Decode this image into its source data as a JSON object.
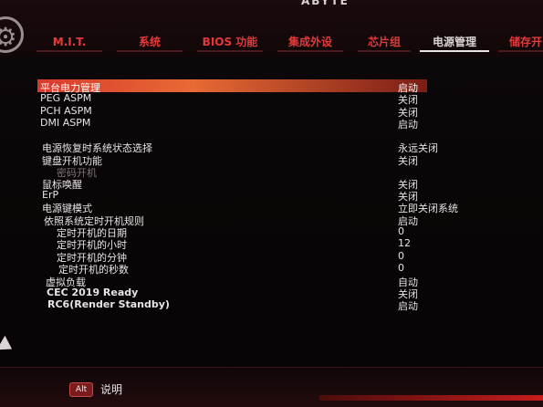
{
  "brand": "ABYTE",
  "tabs": [
    {
      "label": "M.I.T."
    },
    {
      "label": "系统"
    },
    {
      "label": "BIOS 功能"
    },
    {
      "label": "集成外设"
    },
    {
      "label": "芯片组"
    },
    {
      "label": "电源管理"
    },
    {
      "label": "储存开"
    }
  ],
  "active_tab": "电源管理",
  "settings": [
    {
      "label": "平台电力管理",
      "value": "启动",
      "selected": true
    },
    {
      "label": "PEG ASPM",
      "value": "关闭"
    },
    {
      "label": "PCH ASPM",
      "value": "关闭"
    },
    {
      "label": "DMI ASPM",
      "value": "启动"
    },
    {
      "label": "电源恢复时系统状态选择",
      "value": "永远关闭"
    },
    {
      "label": "键盘开机功能",
      "value": "关闭"
    },
    {
      "label": "密码开机",
      "value": "",
      "disabled": true
    },
    {
      "label": "鼠标唤醒",
      "value": "关闭"
    },
    {
      "label": "ErP",
      "value": "关闭"
    },
    {
      "label": "电源键模式",
      "value": "立即关闭系统"
    },
    {
      "label": "依照系统定时开机规则",
      "value": "启动"
    },
    {
      "label": "定时开机的日期",
      "value": "0"
    },
    {
      "label": "定时开机的小时",
      "value": "12"
    },
    {
      "label": "定时开机的分钟",
      "value": "0"
    },
    {
      "label": "定时开机的秒数",
      "value": "0"
    },
    {
      "label": "虚拟负载",
      "value": "自动"
    },
    {
      "label": "CEC 2019 Ready",
      "value": "关闭"
    },
    {
      "label": "RC6(Render Standby)",
      "value": "启动"
    }
  ],
  "footer": {
    "alt_key": "Alt",
    "help_label": "说明"
  },
  "colors": {
    "accent": "#e23a3a",
    "highlight": "#e86a34",
    "background": "#050304"
  }
}
